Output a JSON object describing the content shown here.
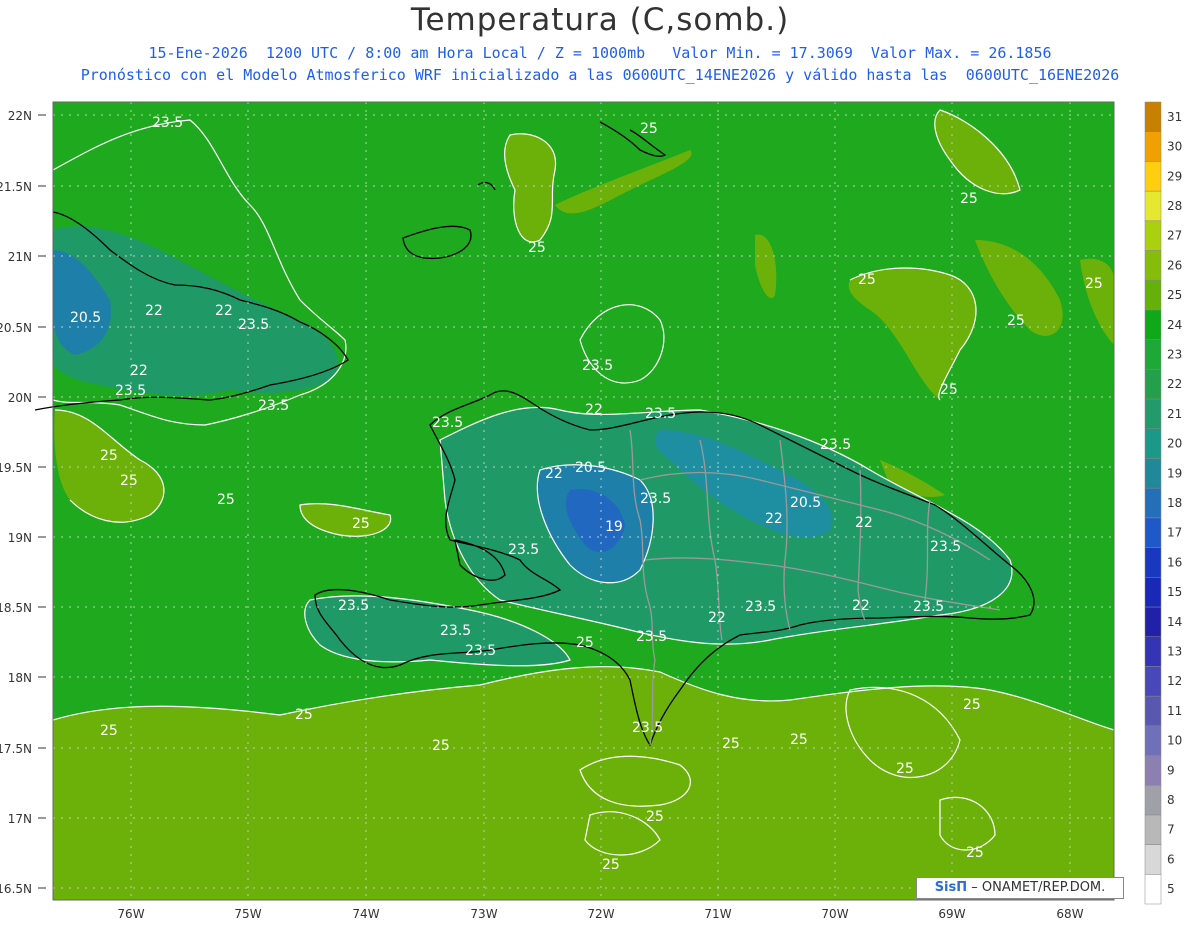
{
  "title": "Temperatura (C,somb.)",
  "subtitle_1": "15-Ene-2026  1200 UTC / 8:00 am Hora Local / Z = 1000mb   Valor Min. = 17.3069  Valor Max. = 26.1856",
  "subtitle_2": "Pronóstico con el Modelo Atmosferico WRF inicializado a las 0600UTC_14ENE2026 y válido hasta las  0600UTC_16ENE2026",
  "credit": {
    "logo": "SisΠ",
    "text": "– ONAMET/REP.DOM."
  },
  "axes": {
    "lat_labels": [
      "22N",
      "21.5N",
      "21N",
      "20.5N",
      "20N",
      "19.5N",
      "19N",
      "18.5N",
      "18N",
      "17.5N",
      "17N",
      "16.5N"
    ],
    "lon_labels": [
      "76W",
      "75W",
      "74W",
      "73W",
      "72W",
      "71W",
      "70W",
      "69W",
      "68W"
    ]
  },
  "colorbar": {
    "levels": [
      "5",
      "6",
      "7",
      "8",
      "9",
      "10",
      "11",
      "12",
      "13",
      "14",
      "15",
      "16",
      "17",
      "18",
      "19",
      "20",
      "21",
      "22",
      "23",
      "24",
      "25",
      "26",
      "27",
      "28",
      "29",
      "30",
      "31"
    ],
    "colors": [
      "#ffffff",
      "#d8d8d8",
      "#b8b8b8",
      "#a0a0a8",
      "#8c80b0",
      "#7070b8",
      "#5858b0",
      "#4848b8",
      "#3434b4",
      "#2020a8",
      "#1a28b8",
      "#1838c0",
      "#1f58c8",
      "#2470b8",
      "#208898",
      "#1c9888",
      "#229a6c",
      "#24a04c",
      "#1ea838",
      "#0fa818",
      "#66b00a",
      "#86bc0a",
      "#aad010",
      "#e6e830",
      "#ffce10",
      "#f0a000",
      "#c88000"
    ]
  },
  "contour_labels": [
    "23.5",
    "25",
    "22",
    "20.5",
    "19"
  ],
  "colors": {
    "ocean": "#1ea91e",
    "warm": "#6cb10a",
    "cool": "#1f9a66",
    "cooler": "#1e7fa8",
    "coldest": "#2168c0",
    "coast": "#000000",
    "border": "#9a9a9a",
    "contour": "#ffffff"
  }
}
